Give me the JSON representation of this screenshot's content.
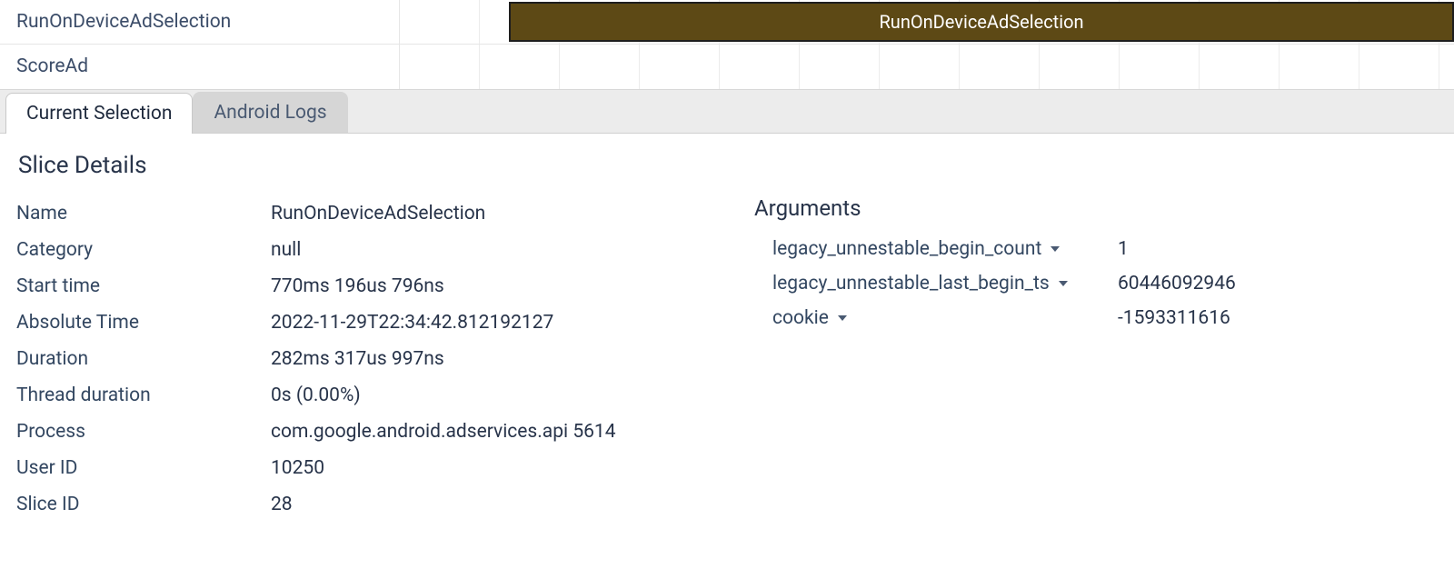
{
  "tracks": {
    "row0_label": "RunOnDeviceAdSelection",
    "row0_slice": "RunOnDeviceAdSelection",
    "row1_label": "ScoreAd"
  },
  "tabs": {
    "current": "Current Selection",
    "logs": "Android Logs"
  },
  "details_title": "Slice Details",
  "details": {
    "name_k": "Name",
    "name_v": "RunOnDeviceAdSelection",
    "category_k": "Category",
    "category_v": "null",
    "start_k": "Start time",
    "start_v": "770ms 196us 796ns",
    "abs_k": "Absolute Time",
    "abs_v": "2022-11-29T22:34:42.812192127",
    "dur_k": "Duration",
    "dur_v": "282ms 317us 997ns",
    "tdur_k": "Thread duration",
    "tdur_v": "0s (0.00%)",
    "proc_k": "Process",
    "proc_v": "com.google.android.adservices.api 5614",
    "uid_k": "User ID",
    "uid_v": "10250",
    "sid_k": "Slice ID",
    "sid_v": "28"
  },
  "arguments_title": "Arguments",
  "args": {
    "a0_k": "legacy_unnestable_begin_count",
    "a0_v": "1",
    "a1_k": "legacy_unnestable_last_begin_ts",
    "a1_v": "60446092946",
    "a2_k": "cookie",
    "a2_v": "-1593311616"
  }
}
